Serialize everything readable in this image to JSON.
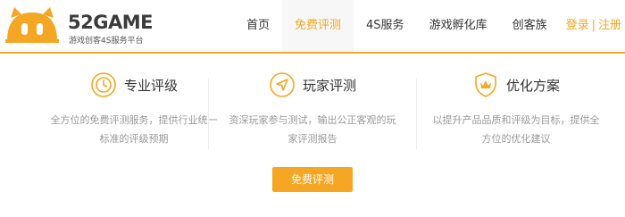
{
  "brand": {
    "name": "52GAME",
    "tagline": "游戏创客4S服务平台",
    "color": "#f5a623"
  },
  "nav": {
    "items": [
      {
        "label": "首页",
        "active": false
      },
      {
        "label": "免费评测",
        "active": true
      },
      {
        "label": "4S服务",
        "active": false
      },
      {
        "label": "游戏孵化库",
        "active": false
      },
      {
        "label": "创客族",
        "active": false
      }
    ]
  },
  "auth": {
    "login": "登录",
    "separator": "|",
    "register": "注册"
  },
  "features": [
    {
      "icon": "clock-icon",
      "title": "专业评级",
      "desc": "全方位的免费评测服务，提供行业统一标准的评级预期"
    },
    {
      "icon": "paper-plane-icon",
      "title": "玩家评测",
      "desc": "资深玩家参与测试，输出公正客观的玩家评测报告"
    },
    {
      "icon": "crown-shield-icon",
      "title": "优化方案",
      "desc": "以提升产品品质和评级为目标，提供全方位的优化建议"
    }
  ],
  "cta": {
    "label": "免费评测"
  }
}
